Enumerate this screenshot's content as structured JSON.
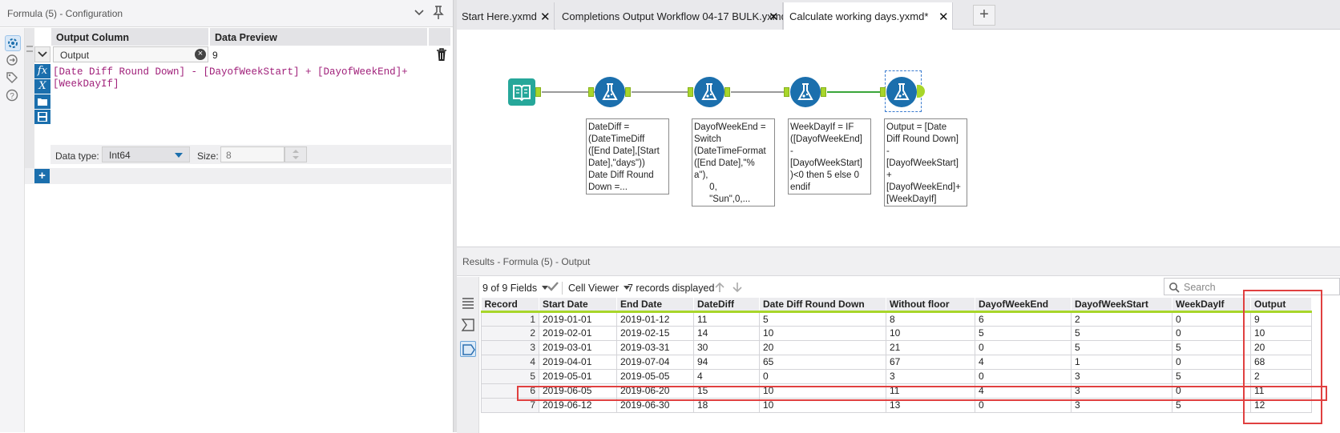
{
  "config": {
    "title": "Formula (5) - Configuration",
    "columns": {
      "output": "Output Column",
      "preview": "Data Preview"
    },
    "row": {
      "output_name": "Output",
      "preview_value": "9"
    },
    "expression": "[Date Diff Round Down] - [DayofWeekStart] + [DayofWeekEnd]+\n[WeekDayIf]",
    "data_type_label": "Data type:",
    "data_type": "Int64",
    "size_label": "Size:",
    "size_value": "8",
    "add_label": "+"
  },
  "tabs": [
    {
      "label": "Start Here.yxmd",
      "active": false
    },
    {
      "label": "Completions Output Workflow 04-17 BULK.yxmd",
      "active": false
    },
    {
      "label": "Calculate working days.yxmd*",
      "active": true
    }
  ],
  "canvas": {
    "annotations": [
      "DateDiff =\n(DateTimeDiff\n([End Date],[Start\nDate],\"days\"))\nDate Diff Round\nDown =...",
      "DayofWeekEnd =\nSwitch\n(DateTimeFormat\n([End Date],\"%\na\"),\n      0,\n      \"Sun\",0,...",
      "WeekDayIf = IF\n([DayofWeekEnd]\n-\n[DayofWeekStart]\n)<0 then 5 else 0\nendif",
      "Output = [Date\nDiff Round Down]\n-\n[DayofWeekStart]\n+\n[DayofWeekEnd]+\n[WeekDayIf]"
    ]
  },
  "results": {
    "title": "Results - Formula (5) - Output",
    "fields_label": "9 of 9 Fields",
    "viewer_label": "Cell Viewer",
    "records_label": "7 records displayed",
    "search_placeholder": "Search",
    "headers": [
      "Record",
      "Start Date",
      "End Date",
      "DateDiff",
      "Date Diff Round Down",
      "Without floor",
      "DayofWeekEnd",
      "DayofWeekStart",
      "WeekDayIf",
      "Output"
    ],
    "rows": [
      [
        "1",
        "2019-01-01",
        "2019-01-12",
        "11",
        "5",
        "8",
        "6",
        "2",
        "0",
        "9"
      ],
      [
        "2",
        "2019-02-01",
        "2019-02-15",
        "14",
        "10",
        "10",
        "5",
        "5",
        "0",
        "10"
      ],
      [
        "3",
        "2019-03-01",
        "2019-03-31",
        "30",
        "20",
        "21",
        "0",
        "5",
        "5",
        "20"
      ],
      [
        "4",
        "2019-04-01",
        "2019-07-04",
        "94",
        "65",
        "67",
        "4",
        "1",
        "0",
        "68"
      ],
      [
        "5",
        "2019-05-01",
        "2019-05-05",
        "4",
        "0",
        "3",
        "0",
        "3",
        "5",
        "2"
      ],
      [
        "6",
        "2019-06-05",
        "2019-06-20",
        "15",
        "10",
        "11",
        "4",
        "3",
        "0",
        "11"
      ],
      [
        "7",
        "2019-06-12",
        "2019-06-30",
        "18",
        "10",
        "13",
        "0",
        "3",
        "5",
        "12"
      ]
    ]
  },
  "colors": {
    "accent": "#1b6fad",
    "anchor": "#a8d62a",
    "highlight": "#e04040"
  }
}
